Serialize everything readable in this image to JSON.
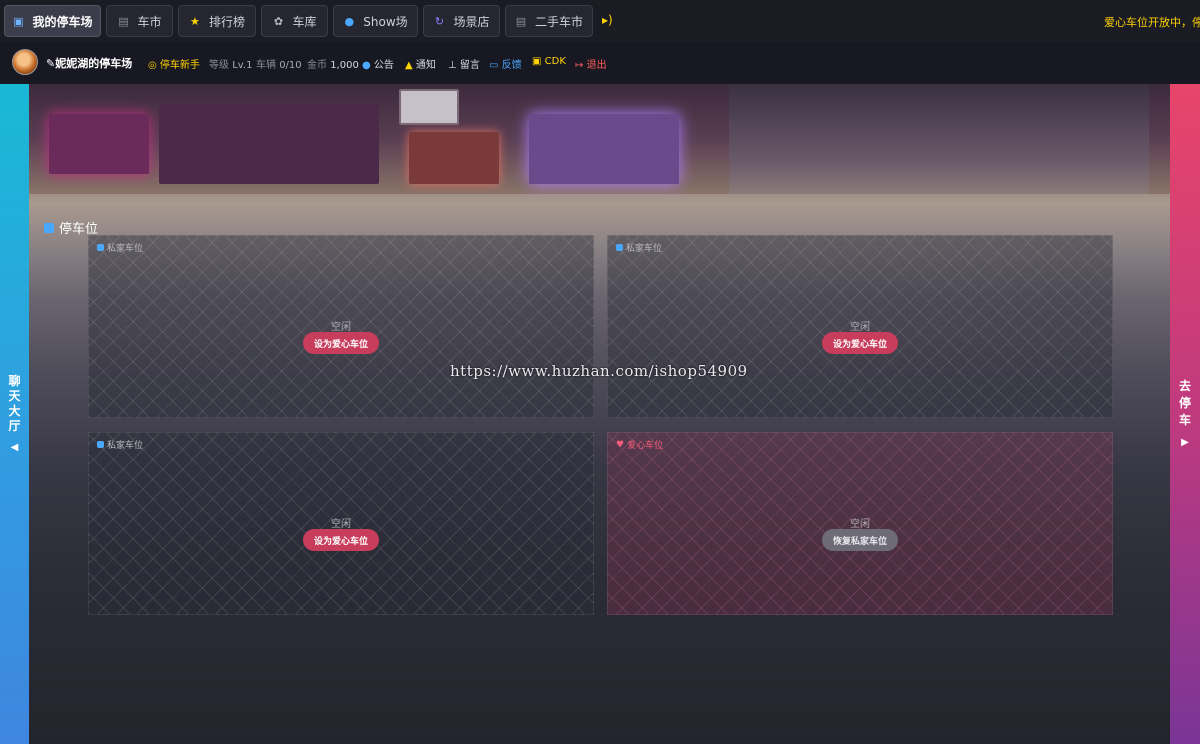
{
  "nav": {
    "tabs": [
      {
        "label": "我的停车场",
        "icon": "lock-icon",
        "active": true
      },
      {
        "label": "车市",
        "icon": "car-icon"
      },
      {
        "label": "排行榜",
        "icon": "star-icon"
      },
      {
        "label": "车库",
        "icon": "gear-icon"
      },
      {
        "label": "Show场",
        "icon": "info-icon"
      },
      {
        "label": "场景店",
        "icon": "refresh-icon"
      },
      {
        "label": "二手车市",
        "icon": "car-icon"
      }
    ],
    "sound_icon": "speaker-icon",
    "announcement": "爱心车位开放中，停车"
  },
  "user": {
    "name": "妮妮湖的停车场",
    "rank": "停车新手",
    "level_label": "等级",
    "level": "Lv.1",
    "cars_label": "车辆",
    "cars": "0/10",
    "coins_label": "金币",
    "coins": "1,000",
    "links": {
      "notice": "公告",
      "notify": "通知",
      "message": "留言",
      "feedback": "反馈",
      "cdk": "CDK",
      "logout": "退出"
    },
    "colors": {
      "rank": "#ffd400",
      "feedback": "#4aa8ff",
      "cdk": "#ffd400",
      "logout": "#ff5c5c"
    }
  },
  "sides": {
    "left": "聊天大厅",
    "left_arrow": "◀",
    "right": "去停车",
    "right_arrow": "▶"
  },
  "section": {
    "title": "停车位"
  },
  "slots": [
    {
      "label": "私家车位",
      "status": "空闲",
      "button": "设为爱心车位",
      "type": "private"
    },
    {
      "label": "私家车位",
      "status": "空闲",
      "button": "设为爱心车位",
      "type": "private"
    },
    {
      "label": "私家车位",
      "status": "空闲",
      "button": "设为爱心车位",
      "type": "private"
    },
    {
      "label": "爱心车位",
      "status": "空闲",
      "button": "恢复私家车位",
      "type": "love"
    }
  ],
  "watermark": "https://www.huzhan.com/ishop54909"
}
